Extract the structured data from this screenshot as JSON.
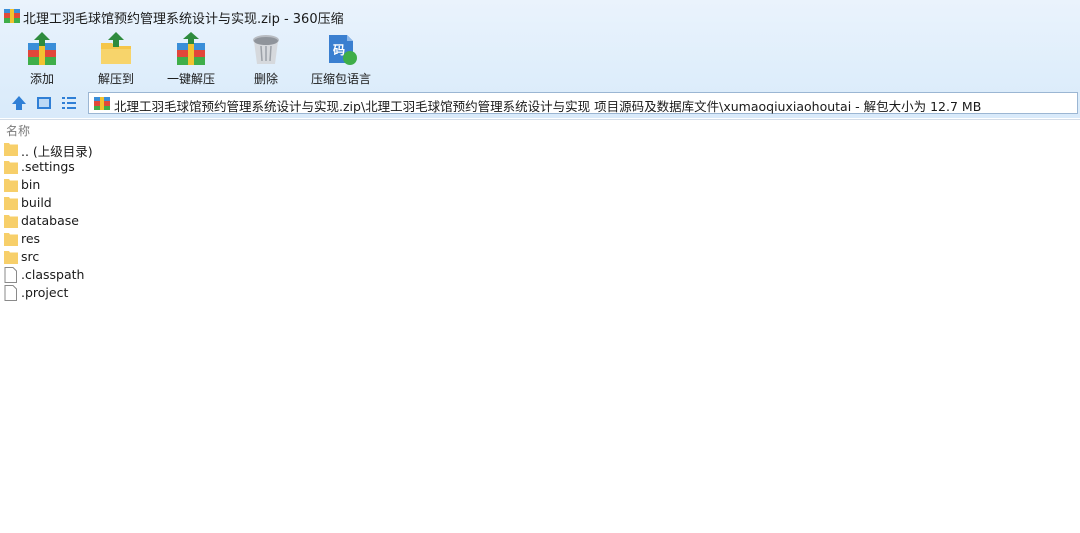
{
  "window": {
    "title": "北理工羽毛球馆预约管理系统设计与实现.zip - 360压缩",
    "app_icon": "archive-icon"
  },
  "toolbar": {
    "items": [
      {
        "label": "添加",
        "icon": "add-archive-icon"
      },
      {
        "label": "解压到",
        "icon": "extract-to-folder-icon"
      },
      {
        "label": "一键解压",
        "icon": "one-click-extract-icon"
      },
      {
        "label": "删除",
        "icon": "trash-bin-icon"
      },
      {
        "label": "压缩包语言",
        "icon": "archive-language-icon",
        "glyph": "码"
      }
    ]
  },
  "address": {
    "path": "北理工羽毛球馆预约管理系统设计与实现.zip\\北理工羽毛球馆预约管理系统设计与实现 项目源码及数据库文件\\xumaoqiuxiaohoutai - 解包大小为 12.7 MB"
  },
  "list": {
    "column_name": "名称",
    "items": [
      {
        "name": ".. (上级目录)",
        "type": "folder"
      },
      {
        "name": ".settings",
        "type": "folder"
      },
      {
        "name": "bin",
        "type": "folder"
      },
      {
        "name": "build",
        "type": "folder"
      },
      {
        "name": "database",
        "type": "folder"
      },
      {
        "name": "res",
        "type": "folder"
      },
      {
        "name": "src",
        "type": "folder"
      },
      {
        "name": ".classpath",
        "type": "file"
      },
      {
        "name": ".project",
        "type": "file"
      }
    ]
  },
  "colors": {
    "chrome_bg": "#dfeefb",
    "folder": "#f7cf6a",
    "nav_blue": "#2f7fd6"
  }
}
